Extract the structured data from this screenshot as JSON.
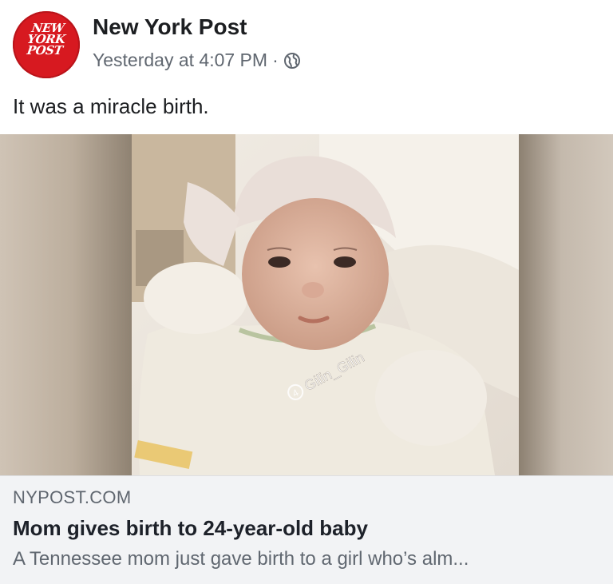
{
  "page": {
    "name": "New York Post",
    "logo_lines": [
      "NEW",
      "YORK",
      "POST"
    ],
    "timestamp": "Yesterday at 4:07 PM",
    "separator": "·",
    "audience_icon": "globe-icon"
  },
  "post": {
    "caption": "It was a miracle birth."
  },
  "photo": {
    "watermark": "Gilin_Gilin"
  },
  "link_preview": {
    "domain": "NYPOST.COM",
    "title": "Mom gives birth to 24-year-old baby",
    "description": "A Tennessee mom just gave birth to a girl who’s alm..."
  },
  "colors": {
    "brand_red": "#d71920",
    "text_primary": "#1c1e21",
    "text_secondary": "#606770",
    "link_card_bg": "#f2f3f5"
  }
}
